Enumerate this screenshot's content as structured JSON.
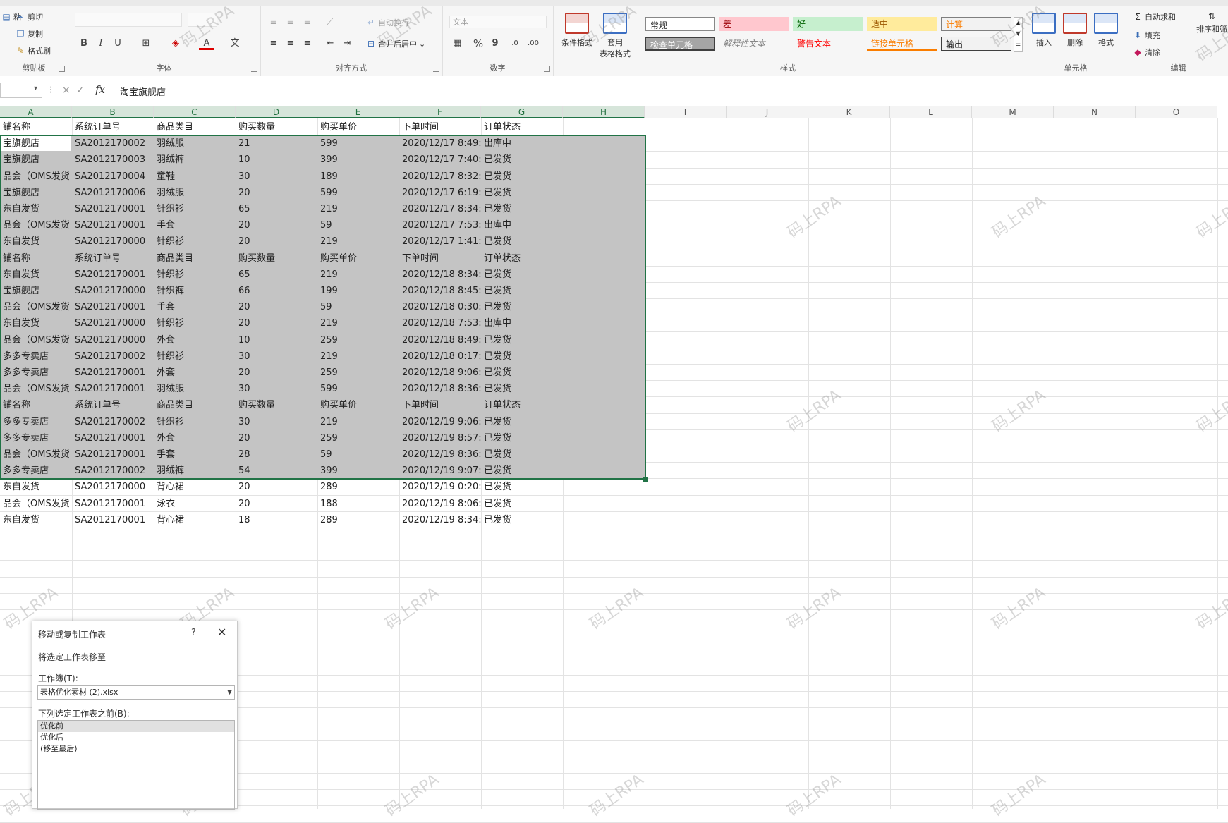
{
  "colors": {
    "accent": "#217346",
    "selection_fill": "#c4c4c4",
    "style_bad_bg": "#ffc7ce",
    "style_bad_fg": "#9c0006",
    "style_good_bg": "#c6efce",
    "style_neutral_bg": "#ffeb9c",
    "style_neutral_fg": "#9c5700",
    "style_calc_bg": "#f2f2f2",
    "style_calc_fg": "#fa7d00",
    "style_check_bg": "#a5a5a5",
    "warning_fg": "#ff0000",
    "linked_fg": "#fa7d00"
  },
  "ribbon": {
    "clipboard": {
      "label": "剪贴板",
      "paste_label": "粘",
      "cut_label": "剪切",
      "copy_label": "复制",
      "format_painter_label": "格式刷",
      "icons": [
        "cut-icon",
        "copy-icon",
        "format-painter-icon"
      ]
    },
    "font": {
      "label": "字体",
      "bold": "B",
      "italic": "I",
      "underline": "U",
      "font_color": "A"
    },
    "alignment": {
      "label": "对齐方式",
      "wrap_label": "自动换行",
      "merge_label": "合并后居中"
    },
    "number": {
      "label": "数字",
      "format_value": "文本",
      "percent": "%",
      "comma": "9"
    },
    "styles": {
      "label": "样式",
      "conditional_format": "条件格式",
      "table_format": "套用",
      "table_format2": "表格格式",
      "boxes": [
        "常规",
        "差",
        "好",
        "适中",
        "计算",
        "检查单元格",
        "解释性文本",
        "警告文本",
        "链接单元格",
        "输出"
      ]
    },
    "cells": {
      "label": "单元格",
      "insert": "插入",
      "delete": "删除",
      "format": "格式"
    },
    "editing": {
      "label": "编辑",
      "autosum": "自动求和",
      "fill": "填充",
      "clear": "清除",
      "sort_filter": "排序和筛"
    }
  },
  "formula_bar": {
    "fx_label": "fx",
    "value": "淘宝旗舰店",
    "cancel": "×",
    "enter": "✓"
  },
  "grid": {
    "columns": [
      "A",
      "B",
      "C",
      "D",
      "E",
      "F",
      "G",
      "H",
      "I",
      "J",
      "K",
      "L",
      "M",
      "N",
      "O"
    ],
    "rows": [
      [
        "铺名称",
        "系统订单号",
        "商品类目",
        "购买数量",
        "购买单价",
        "下单时间",
        "订单状态"
      ],
      [
        "宝旗舰店",
        "SA2012170002",
        "羽绒服",
        "21",
        "599",
        "2020/12/17 8:49:0",
        "出库中"
      ],
      [
        "宝旗舰店",
        "SA2012170003",
        "羽绒裤",
        "10",
        "399",
        "2020/12/17 7:40:0",
        "已发货"
      ],
      [
        "品会（OMS发货",
        "SA2012170004",
        "童鞋",
        "30",
        "189",
        "2020/12/17 8:32:0",
        "已发货"
      ],
      [
        "宝旗舰店",
        "SA2012170006",
        "羽绒服",
        "20",
        "599",
        "2020/12/17 6:19:0",
        "已发货"
      ],
      [
        "东自发货",
        "SA2012170001",
        "针织衫",
        "65",
        "219",
        "2020/12/17 8:34:0",
        "已发货"
      ],
      [
        "品会（OMS发货",
        "SA2012170001",
        "手套",
        "20",
        "59",
        "2020/12/17 7:53:0",
        "出库中"
      ],
      [
        "东自发货",
        "SA2012170000",
        "针织衫",
        "20",
        "219",
        "2020/12/17 1:41:0",
        "已发货"
      ],
      [
        "铺名称",
        "系统订单号",
        "商品类目",
        "购买数量",
        "购买单价",
        "下单时间",
        "订单状态"
      ],
      [
        "东自发货",
        "SA2012170001",
        "针织衫",
        "65",
        "219",
        "2020/12/18 8:34:0",
        "已发货"
      ],
      [
        "宝旗舰店",
        "SA2012170000",
        "针织裤",
        "66",
        "199",
        "2020/12/18 8:45:0",
        "已发货"
      ],
      [
        "品会（OMS发货",
        "SA2012170001",
        "手套",
        "20",
        "59",
        "2020/12/18 0:30:0",
        "已发货"
      ],
      [
        "东自发货",
        "SA2012170000",
        "针织衫",
        "20",
        "219",
        "2020/12/18 7:53:0",
        "出库中"
      ],
      [
        "品会（OMS发货",
        "SA2012170000",
        "外套",
        "10",
        "259",
        "2020/12/18 8:49:1",
        "已发货"
      ],
      [
        "多多专卖店",
        "SA2012170002",
        "针织衫",
        "30",
        "219",
        "2020/12/18 0:17:1",
        "已发货"
      ],
      [
        "多多专卖店",
        "SA2012170001",
        "外套",
        "20",
        "259",
        "2020/12/18 9:06:0",
        "已发货"
      ],
      [
        "品会（OMS发货",
        "SA2012170001",
        "羽绒服",
        "30",
        "599",
        "2020/12/18 8:36:0",
        "已发货"
      ],
      [
        "铺名称",
        "系统订单号",
        "商品类目",
        "购买数量",
        "购买单价",
        "下单时间",
        "订单状态"
      ],
      [
        "多多专卖店",
        "SA2012170002",
        "针织衫",
        "30",
        "219",
        "2020/12/19 9:06:0",
        "已发货"
      ],
      [
        "多多专卖店",
        "SA2012170001",
        "外套",
        "20",
        "259",
        "2020/12/19 8:57:0",
        "已发货"
      ],
      [
        "品会（OMS发货",
        "SA2012170001",
        "手套",
        "28",
        "59",
        "2020/12/19 8:36:0",
        "已发货"
      ],
      [
        "多多专卖店",
        "SA2012170002",
        "羽绒裤",
        "54",
        "399",
        "2020/12/19 9:07:0",
        "已发货"
      ],
      [
        "东自发货",
        "SA2012170000",
        "背心裙",
        "20",
        "289",
        "2020/12/19 0:20:0",
        "已发货"
      ],
      [
        "品会（OMS发货",
        "SA2012170001",
        "泳衣",
        "20",
        "188",
        "2020/12/19 8:06:0",
        "已发货"
      ],
      [
        "东自发货",
        "SA2012170001",
        "背心裙",
        "18",
        "289",
        "2020/12/19 8:34:0",
        "已发货"
      ]
    ]
  },
  "watermark_text": "码上RPA",
  "dialog": {
    "title": "移动或复制工作表",
    "help": "?",
    "close": "✕",
    "description": "将选定工作表移至",
    "workbook_label": "工作簿(T):",
    "workbook_value": "表格优化素材 (2).xlsx",
    "list_label": "下列选定工作表之前(B):",
    "list_items": [
      "优化前",
      "优化后",
      "(移至最后)"
    ]
  }
}
